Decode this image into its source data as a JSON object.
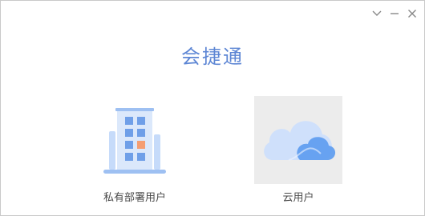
{
  "window": {
    "title": "会捷通",
    "controls": {
      "collapse_icon": "chevron-down-icon",
      "minimize_icon": "minimize-icon",
      "close_icon": "close-icon"
    }
  },
  "options": [
    {
      "label": "私有部署用户",
      "icon": "building-icon",
      "selected": false
    },
    {
      "label": "云用户",
      "icon": "cloud-icon",
      "selected": true
    }
  ],
  "colors": {
    "brand": "#5d86d4",
    "selected_bg": "#ececec",
    "cloud_light": "#cfe0fb",
    "cloud_dark": "#5b9bf0",
    "building_body": "#dbe8fb",
    "building_window": "#6f9fe8",
    "building_window_accent": "#f59e72"
  }
}
